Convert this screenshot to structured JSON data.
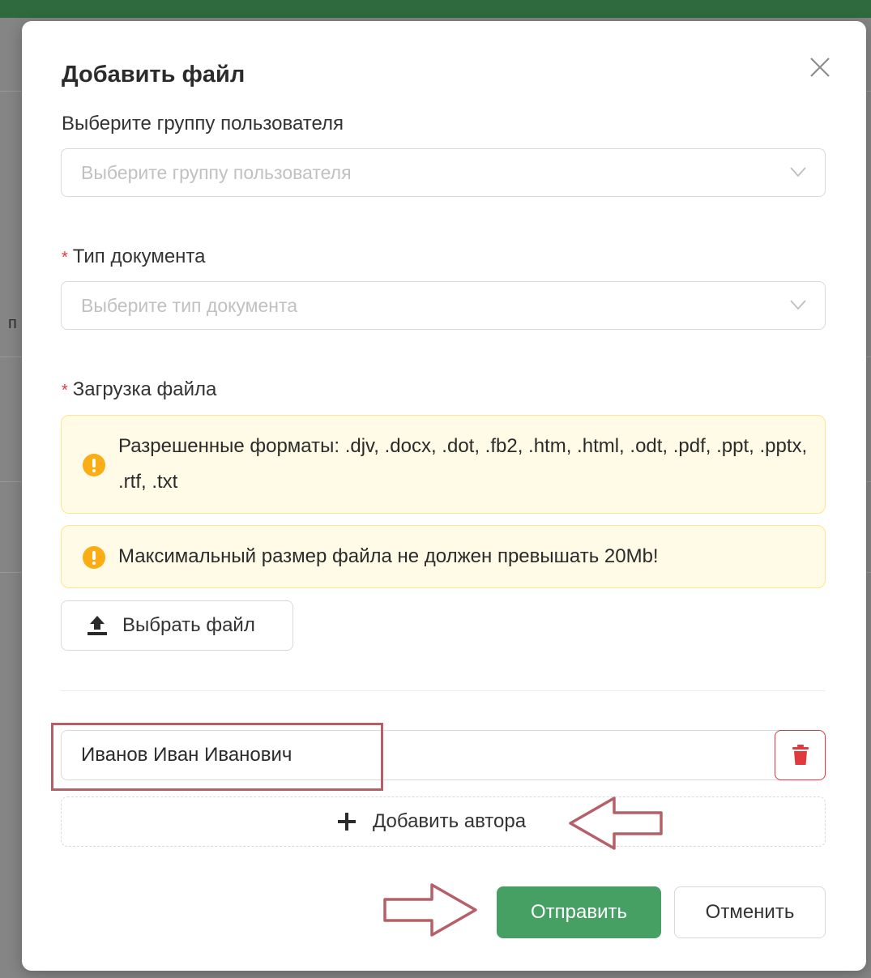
{
  "modal": {
    "title": "Добавить файл"
  },
  "user_group": {
    "label": "Выберите группу пользователя",
    "placeholder": "Выберите группу пользователя"
  },
  "doc_type": {
    "required_mark": "*",
    "label": "Тип документа",
    "placeholder": "Выберите тип документа"
  },
  "upload": {
    "required_mark": "*",
    "label": "Загрузка файла",
    "formats_alert": "Разрешенные форматы: .djv, .docx, .dot, .fb2, .htm, .html, .odt, .pdf, .ppt, .pptx, .rtf, .txt",
    "size_alert": "Максимальный размер файла не должен превышать 20Mb!",
    "button_label": "Выбрать файл"
  },
  "authors": {
    "items": [
      {
        "value": "Иванов Иван Иванович"
      }
    ],
    "add_label": "Добавить автора"
  },
  "footer": {
    "submit_label": "Отправить",
    "cancel_label": "Отменить"
  },
  "colors": {
    "primary_green": "#46a064",
    "danger_red": "#e0393e",
    "warning_bg": "#fffbe6",
    "warning_icon": "#faad14",
    "annotation": "#b56068"
  },
  "background": {
    "partial_text": "п"
  }
}
